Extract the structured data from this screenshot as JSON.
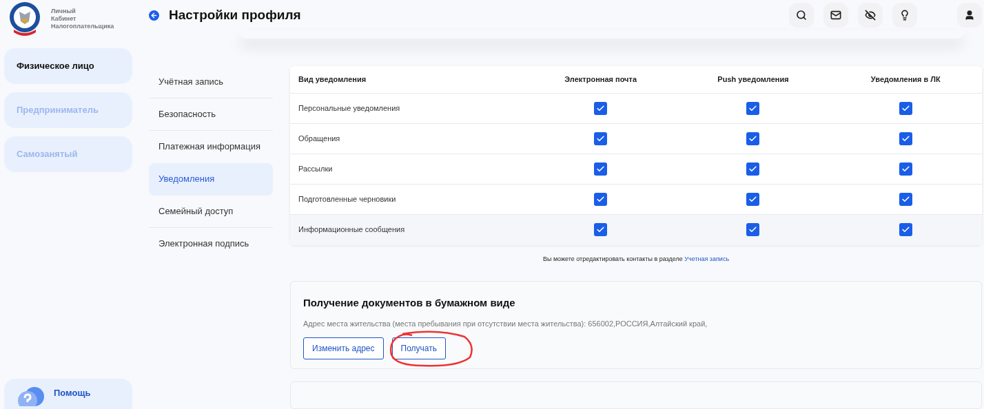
{
  "logo": {
    "lines": [
      "Личный",
      "Кабинет",
      "Налогоплательщика"
    ]
  },
  "header": {
    "title": "Настройки профиля"
  },
  "roles": [
    {
      "label": "Физическое лицо",
      "selected": true
    },
    {
      "label": "Предприниматель",
      "selected": false
    },
    {
      "label": "Самозанятый",
      "selected": false
    }
  ],
  "help": {
    "label": "Помощь"
  },
  "settings_nav": [
    {
      "label": "Учётная запись",
      "selected": false
    },
    {
      "label": "Безопасность",
      "selected": false
    },
    {
      "label": "Платежная информация",
      "selected": false
    },
    {
      "label": "Уведомления",
      "selected": true
    },
    {
      "label": "Семейный доступ",
      "selected": false
    },
    {
      "label": "Электронная подпись",
      "selected": false
    }
  ],
  "table": {
    "columns": [
      "Вид уведомления",
      "Электронная почта",
      "Push уведомления",
      "Уведомления в ЛК"
    ],
    "rows": [
      {
        "name": "Персональные уведомления",
        "checks": [
          true,
          true,
          true
        ]
      },
      {
        "name": "Обращения",
        "checks": [
          true,
          true,
          true
        ]
      },
      {
        "name": "Рассылки",
        "checks": [
          true,
          true,
          true
        ]
      },
      {
        "name": "Подготовленные черновики",
        "checks": [
          true,
          true,
          true
        ]
      },
      {
        "name": "Информационные сообщения",
        "checks": [
          true,
          true,
          true
        ]
      }
    ]
  },
  "note": {
    "text": "Вы можете отредактировать контакты в разделе",
    "link": "Учетная запись"
  },
  "paper": {
    "title": "Получение документов в бумажном виде",
    "address": "Адрес места жительства (места пребывания при отсутствии места жительства): 656002,РОССИЯ,Алтайский край,",
    "buttons": [
      "Изменить адрес",
      "Получать"
    ]
  }
}
